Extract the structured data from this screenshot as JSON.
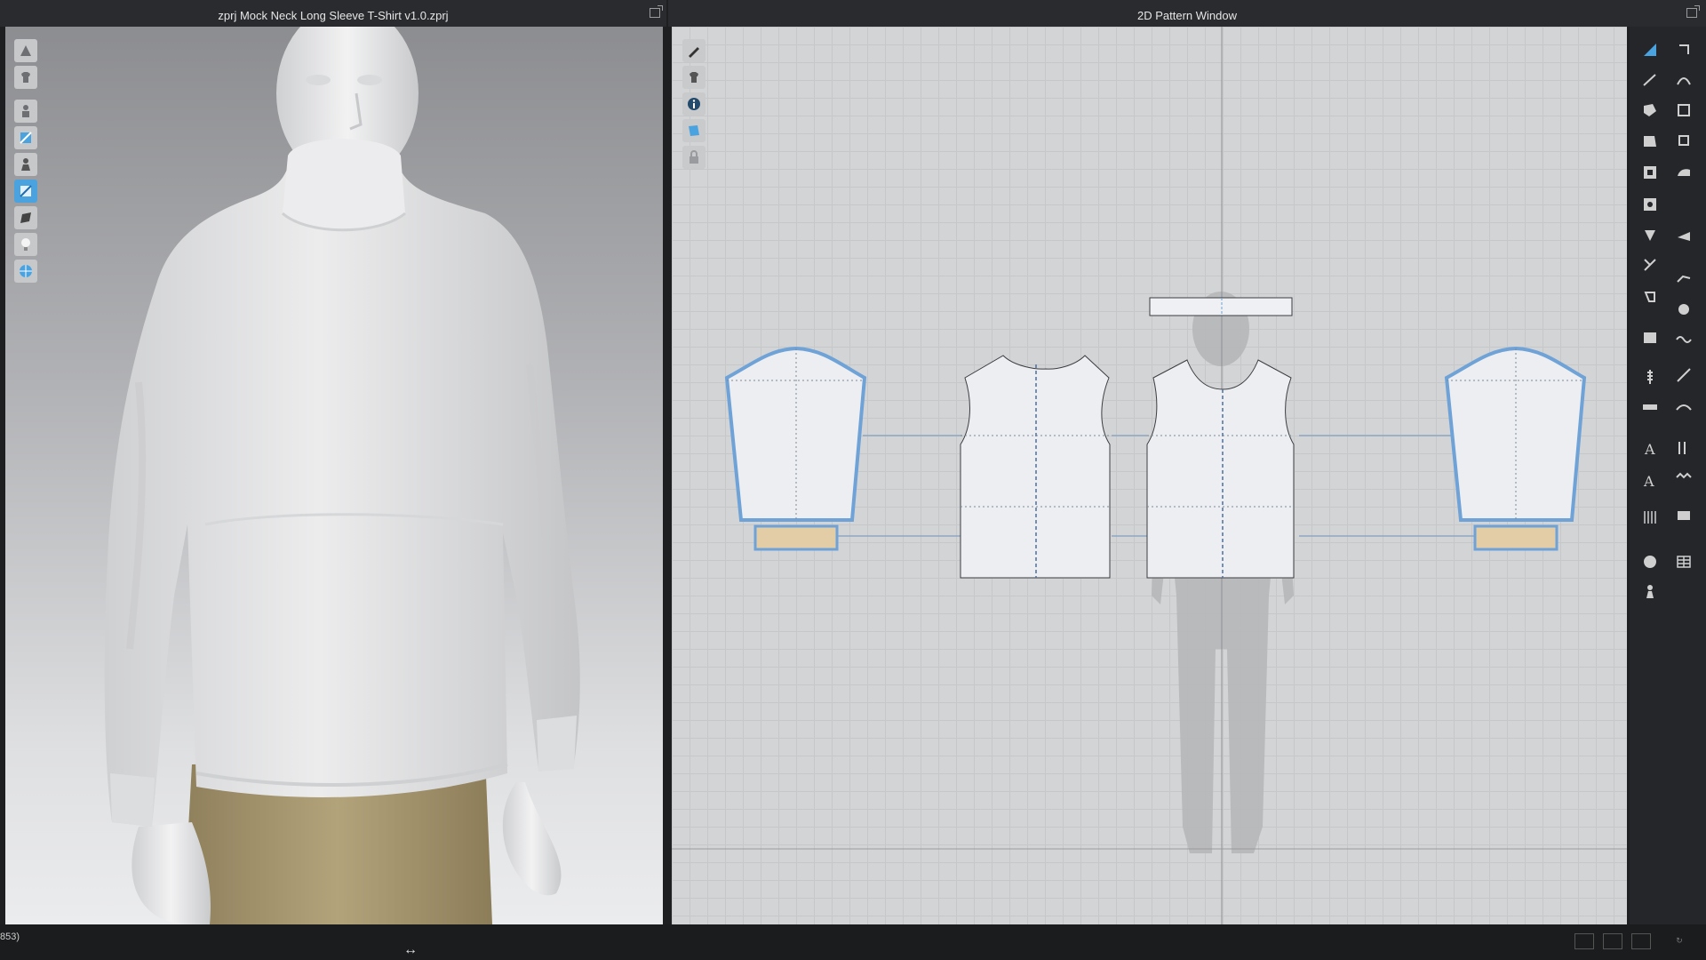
{
  "view3d": {
    "title": "zprj Mock Neck Long Sleeve T-Shirt v1.0.zprj",
    "tools": [
      "avatar-pose-icon",
      "garment-display-icon",
      "avatar-display-icon",
      "fabric-texture-icon",
      "avatar-visibility-icon",
      "garment-render-icon",
      "texture-surface-icon",
      "light-icon",
      "grid-icon"
    ]
  },
  "view2d": {
    "title": "2D Pattern Window",
    "tools": [
      "pen-icon",
      "garment-icon",
      "info-icon",
      "fabric-icon",
      "lock-icon"
    ]
  },
  "status": {
    "left_text": "853)"
  },
  "colors": {
    "accent": "#4aa3df",
    "piece_fill": "#eceef2",
    "seam": "#6fa2d6",
    "cuff": "#e3cda7",
    "pants": "#a8976f",
    "shirt": "#e4e5e6"
  }
}
